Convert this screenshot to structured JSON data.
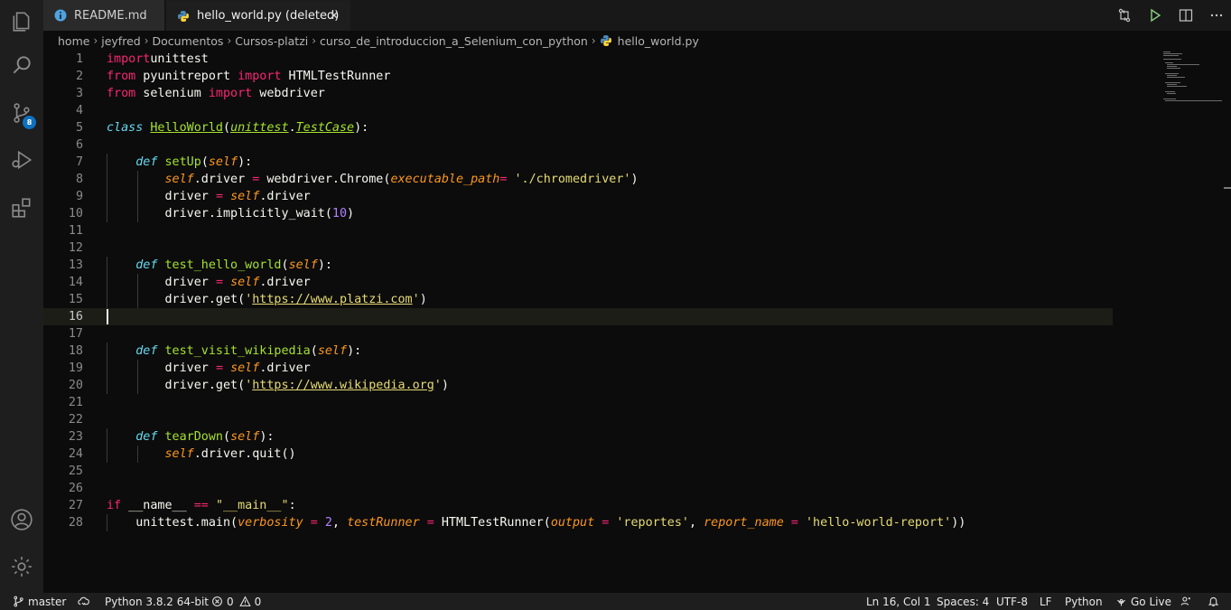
{
  "activity_bar": {
    "items": [
      "explorer-icon",
      "search-icon",
      "source-control-icon",
      "run-debug-icon",
      "extensions-icon",
      "account-icon",
      "manage-gear-icon"
    ],
    "source_control_badge": "8"
  },
  "tabs": [
    {
      "label": "README.md",
      "icon": "info-icon",
      "active": false
    },
    {
      "label": "hello_world.py (deleted)",
      "icon": "python-icon",
      "active": true,
      "close": "✕"
    }
  ],
  "breadcrumb": [
    "home",
    "jeyfred",
    "Documentos",
    "Cursos-platzi",
    "curso_de_introduccion_a_Selenium_con_python",
    "hello_world.py"
  ],
  "editor": {
    "line_numbers": [
      "1",
      "2",
      "3",
      "4",
      "5",
      "6",
      "7",
      "8",
      "9",
      "10",
      "11",
      "12",
      "13",
      "14",
      "15",
      "16",
      "17",
      "18",
      "19",
      "20",
      "21",
      "22",
      "23",
      "24",
      "25",
      "26",
      "27",
      "28"
    ],
    "current_line": 16
  },
  "status_bar": {
    "branch": "master",
    "python": "Python 3.8.2 64-bit",
    "errors": "0",
    "warnings": "0",
    "position": "Ln 16, Col 1",
    "spaces": "Spaces: 4",
    "encoding": "UTF-8",
    "eol": "LF",
    "language": "Python",
    "go_live": "Go Live"
  },
  "colors": {
    "keyword": "#f92672",
    "storage": "#66d9ef",
    "function": "#a6e22e",
    "parameter": "#fd971f",
    "string": "#e6db74",
    "number": "#ae81ff"
  }
}
